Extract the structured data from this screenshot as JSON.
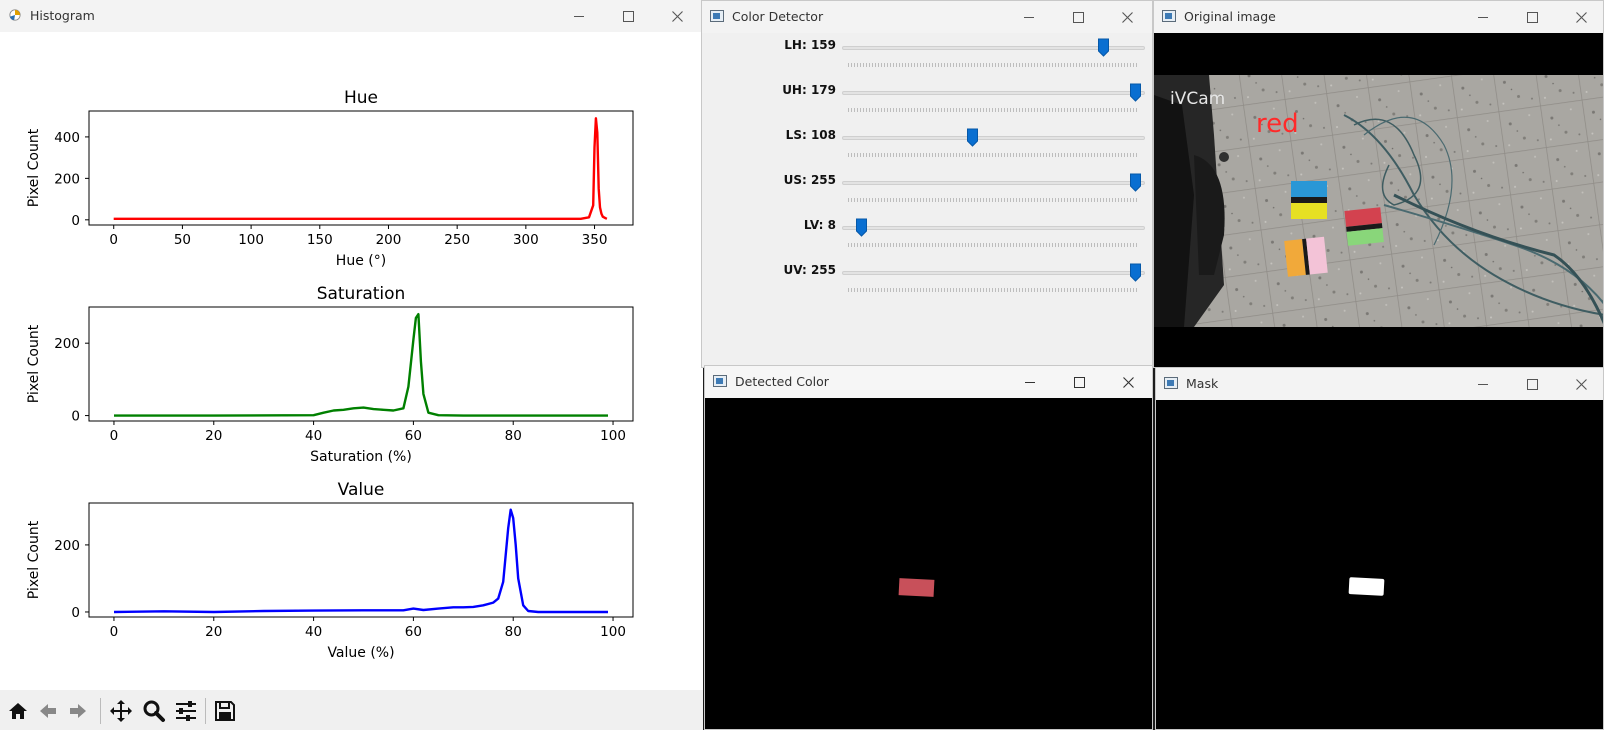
{
  "histogram_window": {
    "title": "Histogram",
    "toolbar": [
      "home-icon",
      "back-arrow-icon",
      "forward-arrow-icon",
      "pan-icon",
      "zoom-icon",
      "configure-subplots-icon",
      "save-icon"
    ]
  },
  "chart_data": [
    {
      "type": "line",
      "title": "Hue",
      "xlabel": "Hue (°)",
      "ylabel": "Pixel Count",
      "color": "#ff0000",
      "xlim": [
        -18,
        378
      ],
      "ylim": [
        -25,
        525
      ],
      "xticks": [
        "0",
        "50",
        "100",
        "150",
        "200",
        "250",
        "300",
        "350"
      ],
      "yticks": [
        "0",
        "200",
        "400"
      ],
      "x": [
        0,
        60,
        120,
        180,
        240,
        300,
        340,
        346,
        349,
        350,
        351,
        352,
        353,
        354,
        355,
        356,
        358,
        359
      ],
      "values": [
        5,
        5,
        5,
        5,
        5,
        5,
        5,
        12,
        70,
        350,
        490,
        420,
        150,
        60,
        30,
        15,
        8,
        5
      ]
    },
    {
      "type": "line",
      "title": "Saturation",
      "xlabel": "Saturation (%)",
      "ylabel": "Pixel Count",
      "color": "#008000",
      "xlim": [
        -5,
        104
      ],
      "ylim": [
        -15,
        300
      ],
      "xticks": [
        "0",
        "20",
        "40",
        "60",
        "80",
        "100"
      ],
      "yticks": [
        "0",
        "200"
      ],
      "x": [
        0,
        20,
        40,
        42,
        44,
        46,
        48,
        50,
        52,
        54,
        56,
        58,
        59,
        60,
        60.5,
        61,
        61.5,
        62,
        63,
        65,
        70,
        80,
        90,
        99
      ],
      "values": [
        0,
        0,
        1,
        8,
        14,
        16,
        20,
        22,
        18,
        16,
        14,
        20,
        80,
        210,
        270,
        280,
        150,
        60,
        8,
        1,
        0,
        0,
        0,
        0
      ]
    },
    {
      "type": "line",
      "title": "Value",
      "xlabel": "Value (%)",
      "ylabel": "Pixel Count",
      "color": "#0000ff",
      "xlim": [
        -5,
        104
      ],
      "ylim": [
        -15,
        325
      ],
      "xticks": [
        "0",
        "20",
        "40",
        "60",
        "80",
        "100"
      ],
      "yticks": [
        "0",
        "200"
      ],
      "x": [
        0,
        10,
        20,
        30,
        40,
        50,
        58,
        60,
        62,
        65,
        68,
        70,
        72,
        74,
        76,
        77,
        78,
        79,
        79.5,
        80,
        80.5,
        81,
        82,
        83,
        85,
        90,
        99
      ],
      "values": [
        0,
        2,
        0,
        3,
        4,
        5,
        5,
        10,
        6,
        10,
        14,
        14,
        15,
        20,
        28,
        40,
        90,
        250,
        305,
        280,
        200,
        100,
        20,
        3,
        0,
        0,
        0
      ]
    }
  ],
  "color_detector": {
    "title": "Color Detector",
    "sliders": [
      {
        "label": "LH: 159",
        "value": 159,
        "max": 179
      },
      {
        "label": "UH: 179",
        "value": 179,
        "max": 179
      },
      {
        "label": "LS: 108",
        "value": 108,
        "max": 255
      },
      {
        "label": "US: 255",
        "value": 255,
        "max": 255
      },
      {
        "label": "LV: 8",
        "value": 8,
        "max": 255
      },
      {
        "label": "UV: 255",
        "value": 255,
        "max": 255
      }
    ]
  },
  "original_image": {
    "title": "Original image",
    "watermark": "iVCam",
    "overlay_text": "red",
    "overlay_color": "#ff2a2a"
  },
  "detected_color": {
    "title": "Detected Color",
    "blob_color": "#c8505a"
  },
  "mask": {
    "title": "Mask",
    "blob_color": "#ffffff"
  },
  "window_controls": {
    "minimize": "—",
    "maximize": "☐",
    "close": "✕"
  }
}
